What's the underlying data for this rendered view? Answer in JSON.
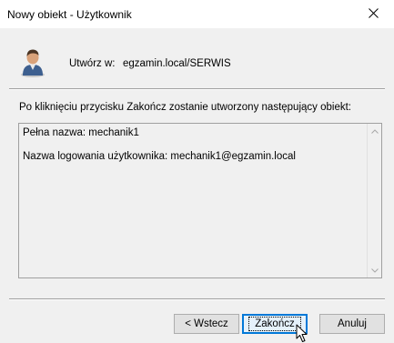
{
  "window": {
    "title": "Nowy obiekt - Użytkownik",
    "close_icon": "close-icon"
  },
  "header": {
    "icon": "user-icon",
    "create_in_label": "Utwórz w:",
    "create_in_value": "egzamin.local/SERWIS"
  },
  "info_text": "Po kliknięciu przycisku Zakończ zostanie utworzony następujący obiekt:",
  "summary": {
    "lines": [
      "Pełna nazwa: mechanik1",
      "Nazwa logowania użytkownika: mechanik1@egzamin.local"
    ]
  },
  "buttons": {
    "back": "< Wstecz",
    "finish": "Zakończ",
    "cancel": "Anuluj"
  },
  "colors": {
    "accent": "#0078d7",
    "dialog_bg": "#f0f0f0"
  }
}
